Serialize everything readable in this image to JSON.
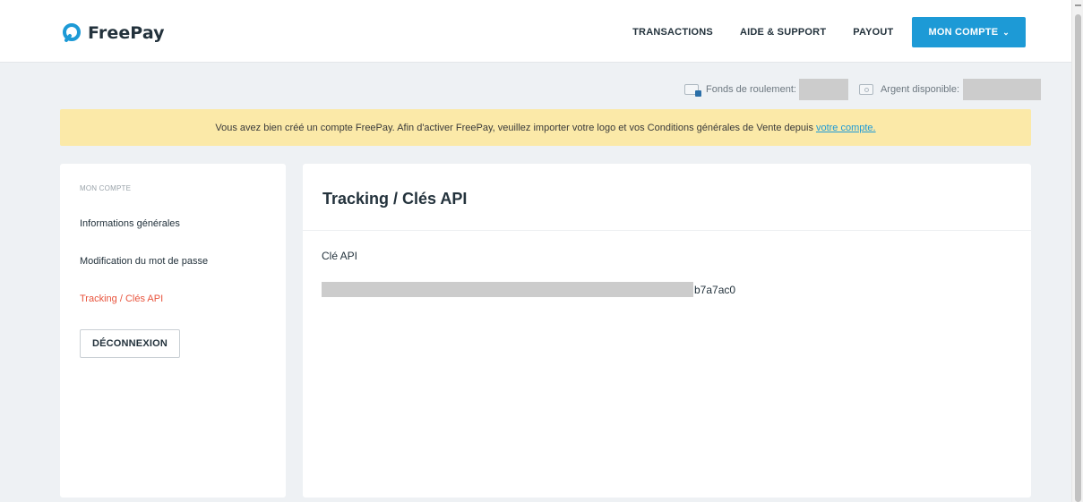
{
  "brand": {
    "name": "FreePay",
    "accent": "#1d9ad6"
  },
  "nav": {
    "links": [
      "TRANSACTIONS",
      "AIDE & SUPPORT",
      "PAYOUT"
    ],
    "account_label": "MON COMPTE"
  },
  "balances": {
    "working_funds_label": "Fonds de roulement:",
    "available_label": "Argent disponible:"
  },
  "notice": {
    "text": "Vous avez bien créé un compte FreePay. Afin d'activer FreePay, veuillez importer votre logo et vos Conditions générales de Vente depuis",
    "link_text": "votre compte.",
    "background": "#fbe9a8"
  },
  "sidebar": {
    "heading": "MON COMPTE",
    "items": [
      {
        "label": "Informations générales",
        "active": false
      },
      {
        "label": "Modification du mot de passe",
        "active": false
      },
      {
        "label": "Tracking / Clés API",
        "active": true
      }
    ],
    "logout_label": "DÉCONNEXION",
    "active_color": "#e8533c"
  },
  "main": {
    "title": "Tracking / Clés API",
    "api_key_label": "Clé API",
    "api_key_visible_suffix": "b7a7ac0"
  }
}
